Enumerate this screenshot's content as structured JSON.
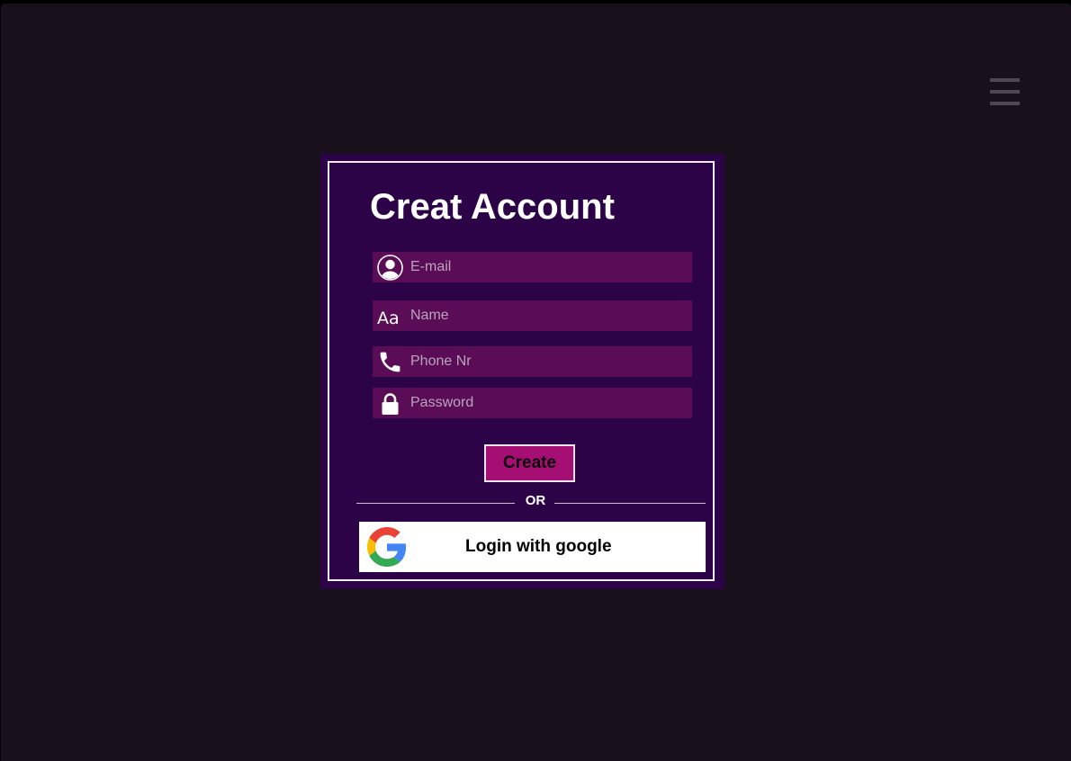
{
  "menu": {
    "icon": "hamburger-menu-icon"
  },
  "form": {
    "title": "Creat Account",
    "fields": [
      {
        "name": "email",
        "placeholder": "E-mail",
        "icon": "user-circle-icon"
      },
      {
        "name": "name",
        "placeholder": "Name",
        "icon": "text-font-icon",
        "icon_text": "Aa"
      },
      {
        "name": "phone",
        "placeholder": "Phone Nr",
        "icon": "phone-icon"
      },
      {
        "name": "password",
        "placeholder": "Password",
        "icon": "lock-icon"
      }
    ],
    "create_label": "Create",
    "divider_label": "OR",
    "google_label": "Login with google",
    "google_icon": "google-logo-icon"
  },
  "colors": {
    "page_background": "#18111c",
    "card_background": "#2c0347",
    "field_background": "#5b0c56",
    "create_button": "#a50f74",
    "google_blue": "#4285f4",
    "google_red": "#ea4335",
    "google_yellow": "#fbbc05",
    "google_green": "#34a853"
  }
}
